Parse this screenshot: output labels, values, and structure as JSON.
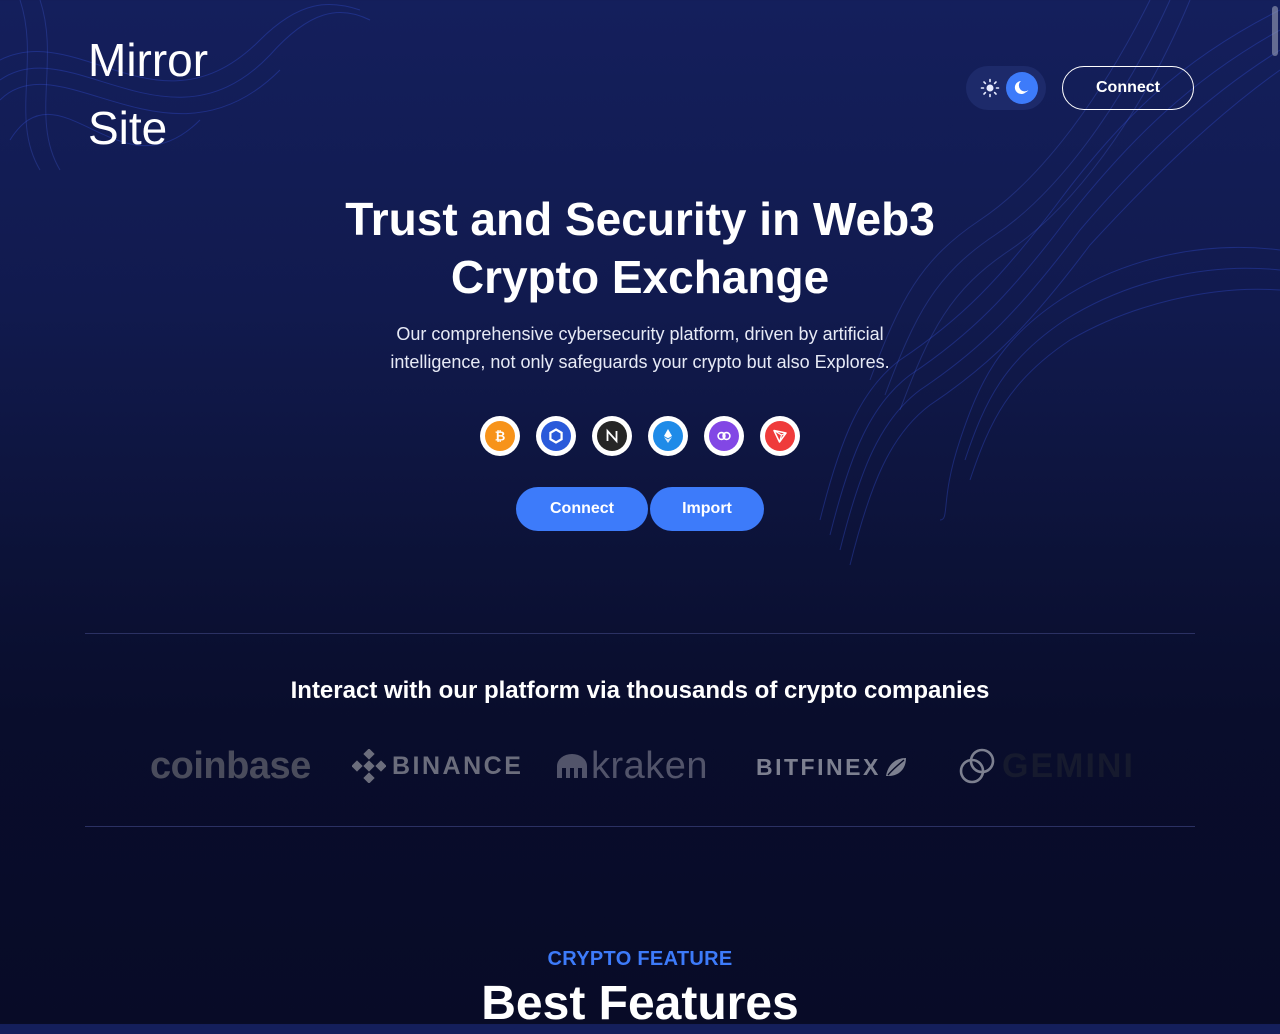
{
  "header": {
    "logo_line1": "Mirror",
    "logo_line2": "Site",
    "connect_label": "Connect",
    "theme_toggle": {
      "light_icon": "sun-icon",
      "dark_icon": "moon-icon",
      "active": "dark"
    }
  },
  "hero": {
    "title_line1": "Trust and Security in Web3",
    "title_line2": "Crypto Exchange",
    "subtitle_line1": "Our comprehensive cybersecurity platform, driven by artificial",
    "subtitle_line2": "intelligence, not only safeguards your crypto but also Explores.",
    "coins": [
      {
        "name": "bitcoin-icon",
        "color": "#f7931a"
      },
      {
        "name": "chainlink-icon",
        "color": "#2a5ada"
      },
      {
        "name": "near-icon",
        "color": "#262626"
      },
      {
        "name": "ethereum-icon",
        "color": "#1f8be8"
      },
      {
        "name": "polygon-icon",
        "color": "#8247e5"
      },
      {
        "name": "tron-icon",
        "color": "#ef3b3b"
      }
    ],
    "connect_label": "Connect",
    "import_label": "Import"
  },
  "partners": {
    "title": "Interact with our platform via thousands of crypto companies",
    "logos": [
      "coinbase",
      "BINANCE",
      "kraken",
      "BITFINEX",
      "GEMINI"
    ]
  },
  "features": {
    "tag": "CRYPTO FEATURE",
    "title": "Best Features"
  },
  "colors": {
    "accent": "#3d7bfa",
    "background": "#0c1237"
  }
}
